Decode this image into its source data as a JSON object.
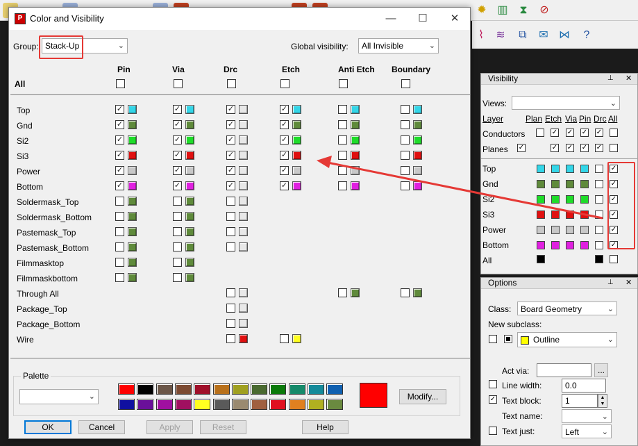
{
  "dialog": {
    "title": "Color and Visibility",
    "minimize": "—",
    "maximize": "☐",
    "close": "✕",
    "group_label": "Group:",
    "group_value": "Stack-Up",
    "global_visibility_label": "Global visibility:",
    "global_visibility_value": "All Invisible",
    "all_label": "All",
    "columns": [
      "Pin",
      "Via",
      "Drc",
      "Etch",
      "Anti Etch",
      "Boundary"
    ],
    "rows": [
      {
        "label": "Top",
        "cells": [
          [
            true,
            "#33d6e8"
          ],
          [
            true,
            "#33d6e8"
          ],
          [
            true,
            "#e8e8e8"
          ],
          [
            true,
            "#33d6e8"
          ],
          [
            false,
            "#33d6e8"
          ],
          [
            false,
            "#33d6e8"
          ]
        ]
      },
      {
        "label": "Gnd",
        "cells": [
          [
            true,
            "#5f8a3b"
          ],
          [
            true,
            "#5f8a3b"
          ],
          [
            true,
            "#e8e8e8"
          ],
          [
            true,
            "#5f8a3b"
          ],
          [
            false,
            "#5f8a3b"
          ],
          [
            false,
            "#5f8a3b"
          ]
        ]
      },
      {
        "label": "Si2",
        "cells": [
          [
            true,
            "#1fdc2a"
          ],
          [
            true,
            "#1fdc2a"
          ],
          [
            true,
            "#e8e8e8"
          ],
          [
            true,
            "#1fdc2a"
          ],
          [
            false,
            "#1fdc2a"
          ],
          [
            false,
            "#1fdc2a"
          ]
        ]
      },
      {
        "label": "Si3",
        "cells": [
          [
            true,
            "#e01010"
          ],
          [
            true,
            "#e01010"
          ],
          [
            true,
            "#e8e8e8"
          ],
          [
            true,
            "#e01010"
          ],
          [
            false,
            "#e01010"
          ],
          [
            false,
            "#e01010"
          ]
        ]
      },
      {
        "label": "Power",
        "cells": [
          [
            true,
            "#c8c8c8"
          ],
          [
            true,
            "#c8c8c8"
          ],
          [
            true,
            "#e8e8e8"
          ],
          [
            true,
            "#c8c8c8"
          ],
          [
            false,
            "#c8c8c8"
          ],
          [
            false,
            "#c8c8c8"
          ]
        ]
      },
      {
        "label": "Bottom",
        "cells": [
          [
            true,
            "#e020e0"
          ],
          [
            true,
            "#e020e0"
          ],
          [
            true,
            "#e8e8e8"
          ],
          [
            true,
            "#e020e0"
          ],
          [
            false,
            "#e020e0"
          ],
          [
            false,
            "#e020e0"
          ]
        ]
      },
      {
        "label": "Soldermask_Top",
        "cells": [
          [
            false,
            "#5f8a3b"
          ],
          [
            false,
            "#5f8a3b"
          ],
          [
            false,
            "#e8e8e8"
          ],
          null,
          null,
          null
        ]
      },
      {
        "label": "Soldermask_Bottom",
        "cells": [
          [
            false,
            "#5f8a3b"
          ],
          [
            false,
            "#5f8a3b"
          ],
          [
            false,
            "#e8e8e8"
          ],
          null,
          null,
          null
        ]
      },
      {
        "label": "Pastemask_Top",
        "cells": [
          [
            false,
            "#5f8a3b"
          ],
          [
            false,
            "#5f8a3b"
          ],
          [
            false,
            "#e8e8e8"
          ],
          null,
          null,
          null
        ]
      },
      {
        "label": "Pastemask_Bottom",
        "cells": [
          [
            false,
            "#5f8a3b"
          ],
          [
            false,
            "#5f8a3b"
          ],
          [
            false,
            "#e8e8e8"
          ],
          null,
          null,
          null
        ]
      },
      {
        "label": "Filmmasktop",
        "cells": [
          [
            false,
            "#5f8a3b"
          ],
          [
            false,
            "#5f8a3b"
          ],
          null,
          null,
          null,
          null
        ]
      },
      {
        "label": "Filmmaskbottom",
        "cells": [
          [
            false,
            "#5f8a3b"
          ],
          [
            false,
            "#5f8a3b"
          ],
          null,
          null,
          null,
          null
        ]
      },
      {
        "label": "Through All",
        "cells": [
          null,
          null,
          [
            false,
            "#e8e8e8"
          ],
          null,
          [
            false,
            "#5f8a3b"
          ],
          [
            false,
            "#5f8a3b"
          ]
        ]
      },
      {
        "label": "Package_Top",
        "cells": [
          null,
          null,
          [
            false,
            "#e8e8e8"
          ],
          null,
          null,
          null
        ]
      },
      {
        "label": "Package_Bottom",
        "cells": [
          null,
          null,
          [
            false,
            "#e8e8e8"
          ],
          null,
          null,
          null
        ]
      },
      {
        "label": "Wire",
        "cells": [
          null,
          null,
          [
            false,
            "#e01010"
          ],
          [
            false,
            "#ffff20"
          ],
          null,
          null
        ]
      }
    ],
    "palette_label": "Palette",
    "palette_colors_row1": [
      "#ff0000",
      "#000000",
      "#6b5648",
      "#7c4a32",
      "#a0102a",
      "#b8701a",
      "#a0a020",
      "#4a6a30",
      "#0a7a0a",
      "#158a6a",
      "#158a9a",
      "#1060b0"
    ],
    "palette_colors_row2": [
      "#1010a0",
      "#6a109a",
      "#a010a0",
      "#a01060",
      "#ffff20",
      "#5a5a5a",
      "#9a8a70",
      "#a06040",
      "#e01020",
      "#e08020",
      "#b0b020",
      "#6a8a40"
    ],
    "selected_color": "#ff0000",
    "modify_button": "Modify...",
    "ok_button": "OK",
    "cancel_button": "Cancel",
    "apply_button": "Apply",
    "reset_button": "Reset",
    "help_button": "Help"
  },
  "visibility_panel": {
    "title": "Visibility",
    "views_label": "Views:",
    "layer_label": "Layer",
    "columns": [
      "Plan",
      "Etch",
      "Via",
      "Pin",
      "Drc",
      "All"
    ],
    "conductors_label": "Conductors",
    "planes_label": "Planes",
    "layers": [
      {
        "label": "Top",
        "color": "#33d6e8"
      },
      {
        "label": "Gnd",
        "color": "#5f8a3b"
      },
      {
        "label": "Si2",
        "color": "#1fdc2a"
      },
      {
        "label": "Si3",
        "color": "#e01010"
      },
      {
        "label": "Power",
        "color": "#c8c8c8"
      },
      {
        "label": "Bottom",
        "color": "#e020e0"
      }
    ],
    "all_label": "All"
  },
  "options_panel": {
    "title": "Options",
    "class_label": "Class:",
    "class_value": "Board Geometry",
    "new_subclass_label": "New subclass:",
    "subclass_value": "Outline",
    "act_via_label": "Act via:",
    "act_via_button": "...",
    "line_width_label": "Line width:",
    "line_width_value": "0.0",
    "text_block_label": "Text block:",
    "text_block_value": "1",
    "text_name_label": "Text name:",
    "text_just_label": "Text just:",
    "text_just_value": "Left"
  }
}
